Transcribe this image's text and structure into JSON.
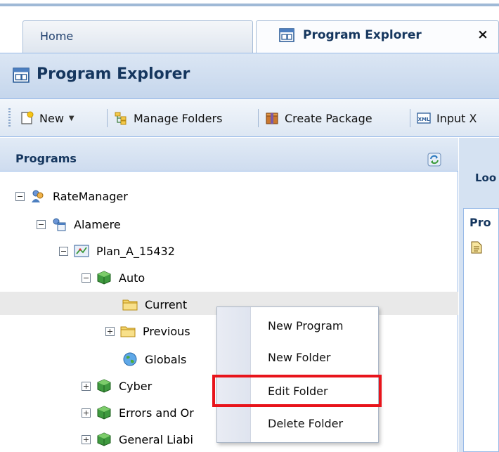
{
  "tabs": [
    {
      "label": "Home",
      "active": false
    },
    {
      "label": "Program Explorer",
      "active": true,
      "close": "×"
    }
  ],
  "panel": {
    "title": "Program Explorer"
  },
  "toolbar": {
    "new": "New",
    "manage_folders": "Manage Folders",
    "create_package": "Create Package",
    "input_x": "Input X"
  },
  "programs": {
    "header": "Programs",
    "tree": [
      {
        "label": "RateManager",
        "icon": "users-icon"
      },
      {
        "label": "Alamere",
        "icon": "company-icon"
      },
      {
        "label": "Plan_A_15432",
        "icon": "plan-icon"
      },
      {
        "label": "Auto",
        "icon": "cube-icon"
      },
      {
        "label": "Current",
        "icon": "folder-icon",
        "selected": true
      },
      {
        "label": "Previous",
        "icon": "folder-icon"
      },
      {
        "label": "Globals",
        "icon": "globe-icon"
      },
      {
        "label": "Cyber",
        "icon": "cube-icon"
      },
      {
        "label": "Errors and Or",
        "icon": "cube-icon"
      },
      {
        "label": "General Liabi",
        "icon": "cube-icon"
      }
    ]
  },
  "right_panel": {
    "header": "Loo",
    "column": "Pro"
  },
  "context_menu": {
    "items": [
      "New Program",
      "New Folder",
      "Edit Folder",
      "Delete Folder"
    ],
    "highlighted": "Edit Folder",
    "highlight_color": "#e8141b"
  }
}
